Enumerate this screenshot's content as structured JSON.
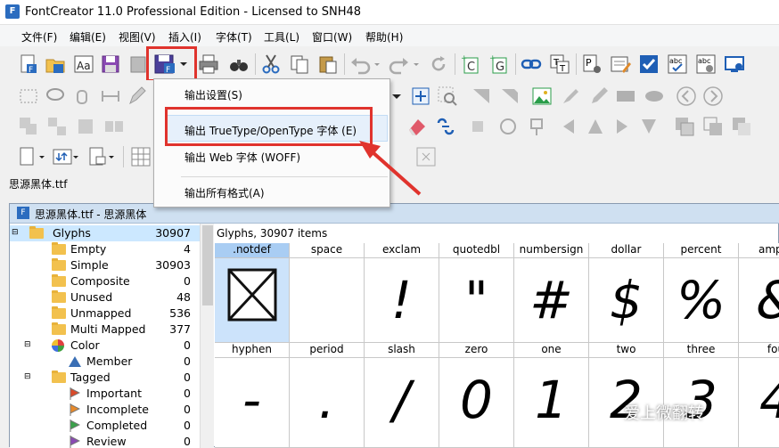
{
  "window": {
    "title": "FontCreator 11.0 Professional Edition - Licensed to SNH48",
    "app_icon": "F"
  },
  "menu": [
    "文件(F)",
    "编辑(E)",
    "视图(V)",
    "插入(I)",
    "字体(T)",
    "工具(L)",
    "窗口(W)",
    "帮助(H)"
  ],
  "export_menu": {
    "items": [
      "输出设置(S)",
      "输出 TrueType/OpenType 字体 (E)",
      "输出 Web 字体 (WOFF)",
      "输出所有格式(A)"
    ]
  },
  "file_tab": "思源黑体.ttf",
  "doc_window": {
    "title": "思源黑体.ttf - 思源黑体",
    "icon": "F"
  },
  "tree": [
    {
      "label": "Glyphs",
      "count": "30907",
      "icon": "folder-icon"
    },
    {
      "label": "Empty",
      "count": "4",
      "icon": "folder-icon"
    },
    {
      "label": "Simple",
      "count": "30903",
      "icon": "folder-icon"
    },
    {
      "label": "Composite",
      "count": "0",
      "icon": "folder-icon"
    },
    {
      "label": "Unused",
      "count": "48",
      "icon": "folder-icon"
    },
    {
      "label": "Unmapped",
      "count": "536",
      "icon": "folder-icon"
    },
    {
      "label": "Multi Mapped",
      "count": "377",
      "icon": "folder-icon"
    },
    {
      "label": "Color",
      "count": "0",
      "icon": "color-wheel-icon"
    },
    {
      "label": "Member",
      "count": "0",
      "icon": "triangle-icon"
    },
    {
      "label": "Tagged",
      "count": "0",
      "icon": "folder-icon"
    },
    {
      "label": "Important",
      "count": "0",
      "icon": "flag-red-icon"
    },
    {
      "label": "Incomplete",
      "count": "0",
      "icon": "flag-orange-icon"
    },
    {
      "label": "Completed",
      "count": "0",
      "icon": "flag-green-icon"
    },
    {
      "label": "Review",
      "count": "0",
      "icon": "flag-purple-icon"
    }
  ],
  "grid": {
    "header": "Glyphs, 30907 items",
    "row1": [
      {
        "name": ".notdef",
        "glyph": ""
      },
      {
        "name": "space",
        "glyph": ""
      },
      {
        "name": "exclam",
        "glyph": "!"
      },
      {
        "name": "quotedbl",
        "glyph": "\""
      },
      {
        "name": "numbersign",
        "glyph": "#"
      },
      {
        "name": "dollar",
        "glyph": "$"
      },
      {
        "name": "percent",
        "glyph": "%"
      },
      {
        "name": "amper",
        "glyph": "&"
      }
    ],
    "row2": [
      {
        "name": "hyphen",
        "glyph": "-"
      },
      {
        "name": "period",
        "glyph": "."
      },
      {
        "name": "slash",
        "glyph": "/"
      },
      {
        "name": "zero",
        "glyph": "0"
      },
      {
        "name": "one",
        "glyph": "1"
      },
      {
        "name": "two",
        "glyph": "2"
      },
      {
        "name": "three",
        "glyph": "3"
      },
      {
        "name": "fou",
        "glyph": "4"
      }
    ]
  },
  "watermark": "爱上微翻转",
  "colors": {
    "highlight_red": "#e0332d",
    "selection": "#cce8ff"
  }
}
